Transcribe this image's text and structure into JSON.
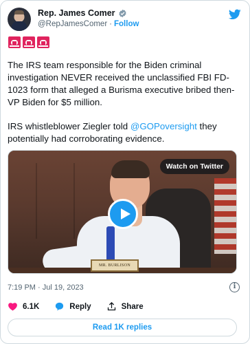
{
  "author": {
    "name": "Rep. James Comer",
    "handle": "@RepJamesComer",
    "follow_label": "Follow",
    "separator": "·"
  },
  "emoji": [
    "siren",
    "siren",
    "siren"
  ],
  "tweet": {
    "paragraph1": "The IRS team responsible for the Biden criminal investigation NEVER received the unclassified FBI FD-1023 form that alleged a Burisma executive bribed then-VP Biden for $5 million.",
    "paragraph2_before": "IRS whistleblower Ziegler told ",
    "paragraph2_mention": "@GOPoversight",
    "paragraph2_after": " they potentially had corroborating evidence."
  },
  "media": {
    "watch_label": "Watch on Twitter",
    "nameplate": "MR. BURLISON"
  },
  "timestamp": "7:19 PM · Jul 19, 2023",
  "actions": {
    "like_count": "6.1K",
    "reply_label": "Reply",
    "share_label": "Share"
  },
  "read_replies_label": "Read 1K replies",
  "colors": {
    "accent": "#1d9bf0",
    "like": "#f91880",
    "text": "#0f1419",
    "muted": "#536471"
  }
}
